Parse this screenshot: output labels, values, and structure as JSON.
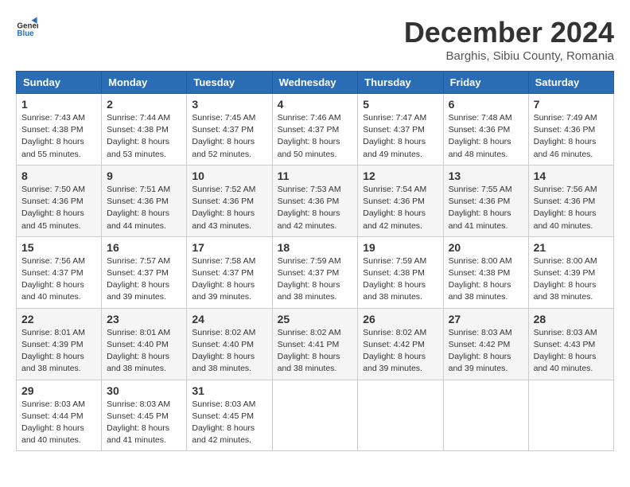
{
  "header": {
    "logo_line1": "General",
    "logo_line2": "Blue",
    "month_title": "December 2024",
    "location": "Barghis, Sibiu County, Romania"
  },
  "days_of_week": [
    "Sunday",
    "Monday",
    "Tuesday",
    "Wednesday",
    "Thursday",
    "Friday",
    "Saturday"
  ],
  "weeks": [
    [
      {
        "day": "1",
        "sunrise": "7:43 AM",
        "sunset": "4:38 PM",
        "daylight": "8 hours and 55 minutes."
      },
      {
        "day": "2",
        "sunrise": "7:44 AM",
        "sunset": "4:38 PM",
        "daylight": "8 hours and 53 minutes."
      },
      {
        "day": "3",
        "sunrise": "7:45 AM",
        "sunset": "4:37 PM",
        "daylight": "8 hours and 52 minutes."
      },
      {
        "day": "4",
        "sunrise": "7:46 AM",
        "sunset": "4:37 PM",
        "daylight": "8 hours and 50 minutes."
      },
      {
        "day": "5",
        "sunrise": "7:47 AM",
        "sunset": "4:37 PM",
        "daylight": "8 hours and 49 minutes."
      },
      {
        "day": "6",
        "sunrise": "7:48 AM",
        "sunset": "4:36 PM",
        "daylight": "8 hours and 48 minutes."
      },
      {
        "day": "7",
        "sunrise": "7:49 AM",
        "sunset": "4:36 PM",
        "daylight": "8 hours and 46 minutes."
      }
    ],
    [
      {
        "day": "8",
        "sunrise": "7:50 AM",
        "sunset": "4:36 PM",
        "daylight": "8 hours and 45 minutes."
      },
      {
        "day": "9",
        "sunrise": "7:51 AM",
        "sunset": "4:36 PM",
        "daylight": "8 hours and 44 minutes."
      },
      {
        "day": "10",
        "sunrise": "7:52 AM",
        "sunset": "4:36 PM",
        "daylight": "8 hours and 43 minutes."
      },
      {
        "day": "11",
        "sunrise": "7:53 AM",
        "sunset": "4:36 PM",
        "daylight": "8 hours and 42 minutes."
      },
      {
        "day": "12",
        "sunrise": "7:54 AM",
        "sunset": "4:36 PM",
        "daylight": "8 hours and 42 minutes."
      },
      {
        "day": "13",
        "sunrise": "7:55 AM",
        "sunset": "4:36 PM",
        "daylight": "8 hours and 41 minutes."
      },
      {
        "day": "14",
        "sunrise": "7:56 AM",
        "sunset": "4:36 PM",
        "daylight": "8 hours and 40 minutes."
      }
    ],
    [
      {
        "day": "15",
        "sunrise": "7:56 AM",
        "sunset": "4:37 PM",
        "daylight": "8 hours and 40 minutes."
      },
      {
        "day": "16",
        "sunrise": "7:57 AM",
        "sunset": "4:37 PM",
        "daylight": "8 hours and 39 minutes."
      },
      {
        "day": "17",
        "sunrise": "7:58 AM",
        "sunset": "4:37 PM",
        "daylight": "8 hours and 39 minutes."
      },
      {
        "day": "18",
        "sunrise": "7:59 AM",
        "sunset": "4:37 PM",
        "daylight": "8 hours and 38 minutes."
      },
      {
        "day": "19",
        "sunrise": "7:59 AM",
        "sunset": "4:38 PM",
        "daylight": "8 hours and 38 minutes."
      },
      {
        "day": "20",
        "sunrise": "8:00 AM",
        "sunset": "4:38 PM",
        "daylight": "8 hours and 38 minutes."
      },
      {
        "day": "21",
        "sunrise": "8:00 AM",
        "sunset": "4:39 PM",
        "daylight": "8 hours and 38 minutes."
      }
    ],
    [
      {
        "day": "22",
        "sunrise": "8:01 AM",
        "sunset": "4:39 PM",
        "daylight": "8 hours and 38 minutes."
      },
      {
        "day": "23",
        "sunrise": "8:01 AM",
        "sunset": "4:40 PM",
        "daylight": "8 hours and 38 minutes."
      },
      {
        "day": "24",
        "sunrise": "8:02 AM",
        "sunset": "4:40 PM",
        "daylight": "8 hours and 38 minutes."
      },
      {
        "day": "25",
        "sunrise": "8:02 AM",
        "sunset": "4:41 PM",
        "daylight": "8 hours and 38 minutes."
      },
      {
        "day": "26",
        "sunrise": "8:02 AM",
        "sunset": "4:42 PM",
        "daylight": "8 hours and 39 minutes."
      },
      {
        "day": "27",
        "sunrise": "8:03 AM",
        "sunset": "4:42 PM",
        "daylight": "8 hours and 39 minutes."
      },
      {
        "day": "28",
        "sunrise": "8:03 AM",
        "sunset": "4:43 PM",
        "daylight": "8 hours and 40 minutes."
      }
    ],
    [
      {
        "day": "29",
        "sunrise": "8:03 AM",
        "sunset": "4:44 PM",
        "daylight": "8 hours and 40 minutes."
      },
      {
        "day": "30",
        "sunrise": "8:03 AM",
        "sunset": "4:45 PM",
        "daylight": "8 hours and 41 minutes."
      },
      {
        "day": "31",
        "sunrise": "8:03 AM",
        "sunset": "4:45 PM",
        "daylight": "8 hours and 42 minutes."
      },
      null,
      null,
      null,
      null
    ]
  ]
}
